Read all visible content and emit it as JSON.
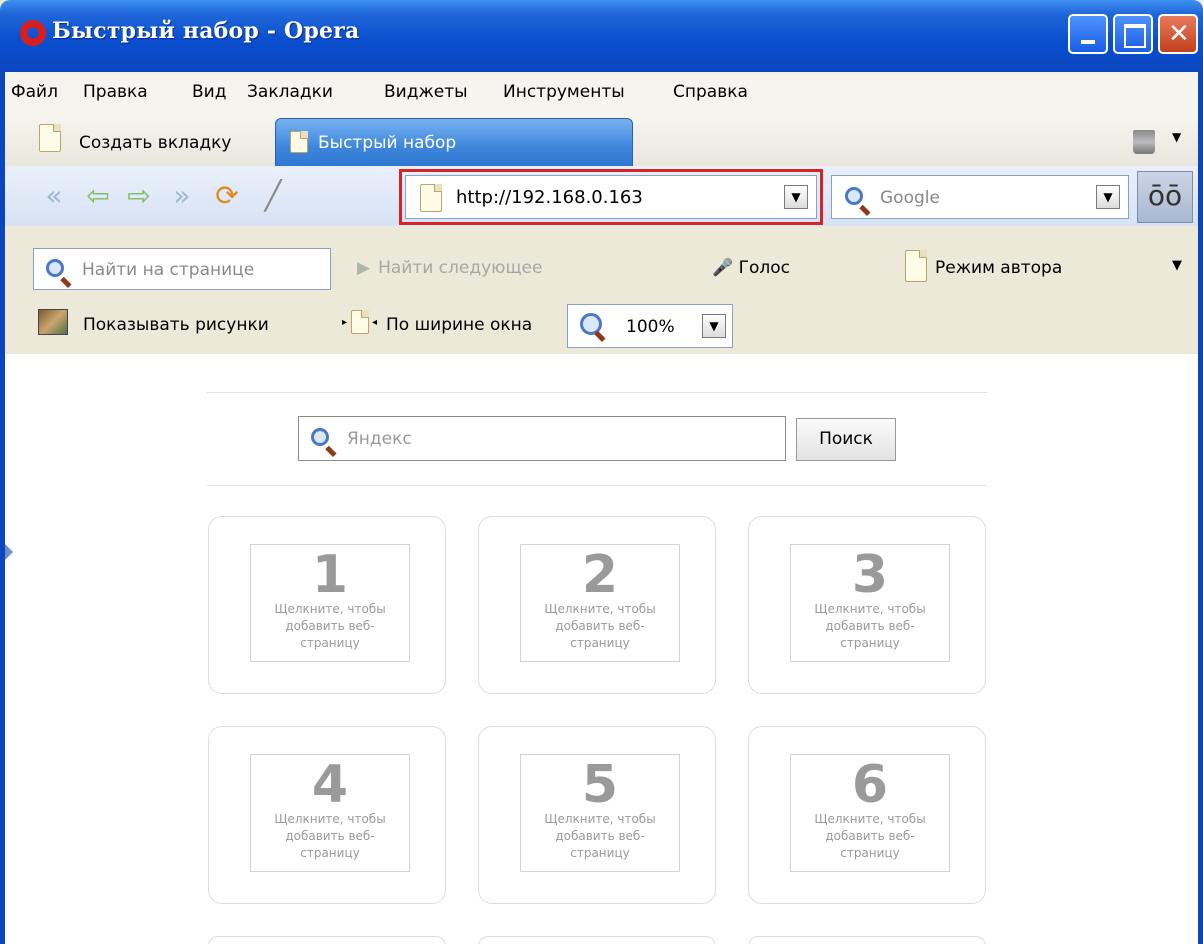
{
  "window": {
    "title": "Быстрый набор - Opera"
  },
  "menu": [
    "Файл",
    "Правка",
    "Вид",
    "Закладки",
    "Виджеты",
    "Инструменты",
    "Справка"
  ],
  "tabs": {
    "new_tab": "Создать вкладку",
    "active_tab": "Быстрый набор"
  },
  "nav": {
    "address": "http://192.168.0.163",
    "search_engine": "Google",
    "icons": [
      "rewind-icon",
      "back-icon",
      "forward-icon",
      "fast-forward-icon",
      "reload-icon",
      "wand-icon"
    ]
  },
  "findbar": {
    "find_placeholder": "Найти на странице",
    "find_next": "Найти следующее",
    "voice": "Голос",
    "author_mode": "Режим автора",
    "show_images": "Показывать рисунки",
    "fit_width": "По ширине окна",
    "zoom": "100%"
  },
  "speed_dial": {
    "search_placeholder": "Яндекс",
    "search_button": "Поиск",
    "cells": [
      {
        "number": "1",
        "text": "Щелкните, чтобы добавить веб-страницу"
      },
      {
        "number": "2",
        "text": "Щелкните, чтобы добавить веб-страницу"
      },
      {
        "number": "3",
        "text": "Щелкните, чтобы добавить веб-страницу"
      },
      {
        "number": "4",
        "text": "Щелкните, чтобы добавить веб-страницу"
      },
      {
        "number": "5",
        "text": "Щелкните, чтобы добавить веб-страницу"
      },
      {
        "number": "6",
        "text": "Щелкните, чтобы добавить веб-страницу"
      }
    ]
  },
  "colors": {
    "titlebar": "#0b46be",
    "active_tab": "#3e86dc",
    "highlight": "#d42424"
  }
}
